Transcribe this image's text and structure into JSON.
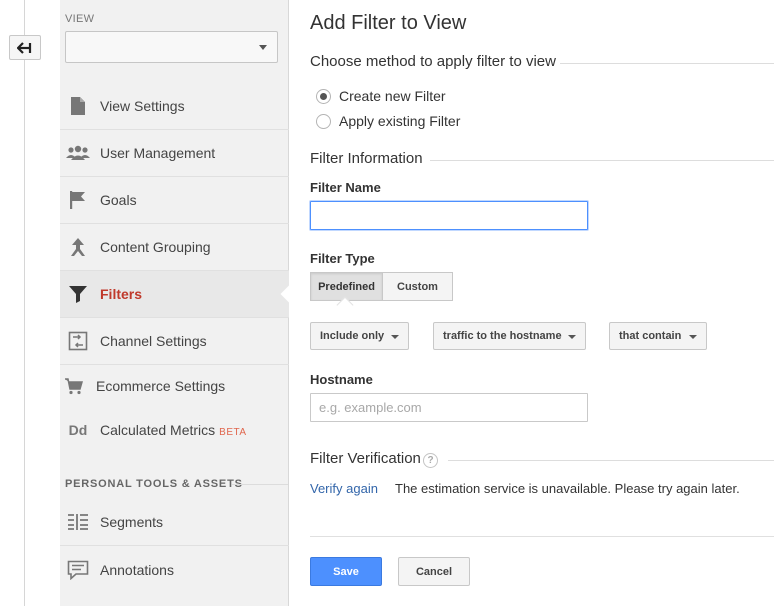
{
  "sidebar": {
    "view_label": "VIEW",
    "view_select_value": "",
    "items": [
      {
        "label": "View Settings",
        "icon": "document-icon"
      },
      {
        "label": "User Management",
        "icon": "users-icon"
      },
      {
        "label": "Goals",
        "icon": "flag-icon"
      },
      {
        "label": "Content Grouping",
        "icon": "content-grouping-icon"
      },
      {
        "label": "Filters",
        "icon": "filter-icon",
        "active": true
      },
      {
        "label": "Channel Settings",
        "icon": "channel-settings-icon"
      },
      {
        "label": "Ecommerce Settings",
        "icon": "cart-icon"
      },
      {
        "label": "Calculated Metrics",
        "badge": "BETA",
        "icon": "dd-icon"
      }
    ],
    "tools_section_title": "PERSONAL TOOLS & ASSETS",
    "tools": [
      {
        "label": "Segments",
        "icon": "segments-icon"
      },
      {
        "label": "Annotations",
        "icon": "annotation-icon"
      }
    ]
  },
  "main": {
    "title": "Add Filter to View",
    "method_heading": "Choose method to apply filter to view",
    "method_options": [
      {
        "label": "Create new Filter",
        "checked": true
      },
      {
        "label": "Apply existing Filter",
        "checked": false
      }
    ],
    "info_heading": "Filter Information",
    "filter_name_label": "Filter Name",
    "filter_name_value": "",
    "filter_type_label": "Filter Type",
    "filter_type_tabs": [
      "Predefined",
      "Custom"
    ],
    "filter_type_selected": "Predefined",
    "dropdowns": [
      "Include only",
      "traffic to the hostname",
      "that contain"
    ],
    "hostname_label": "Hostname",
    "hostname_placeholder": "e.g. example.com",
    "verification_heading": "Filter Verification",
    "help_glyph": "?",
    "verify_link": "Verify again",
    "verify_message": "The estimation service is unavailable. Please try again later.",
    "save_label": "Save",
    "cancel_label": "Cancel"
  },
  "colors": {
    "accent_blue": "#4d90fe",
    "active_red": "#c0392b",
    "link_blue": "#3366aa",
    "sidebar_bg": "#f1f1f1"
  }
}
